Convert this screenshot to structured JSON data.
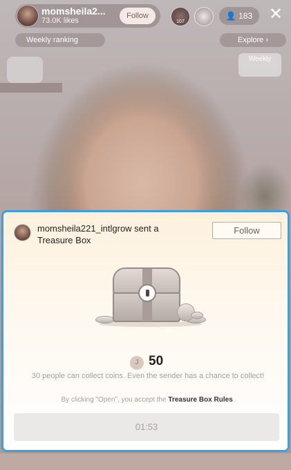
{
  "host": {
    "name": "momsheila2...",
    "likes": "73.0K likes",
    "follow_label": "Follow"
  },
  "viewers": {
    "count": "183",
    "avatar1_badge": "107",
    "avatar2_badge": ""
  },
  "ranking": {
    "label": "Weekly ranking"
  },
  "explore": {
    "label": "Explore"
  },
  "weekly_box": {
    "title": "Weekly",
    "subtitle": ""
  },
  "modal": {
    "sender_text": "momsheila221_intlgrow sent a Treasure Box",
    "follow_label": "Follow",
    "coin_symbol": "J",
    "coin_amount": "50",
    "description": "30 people can collect coins. Even the sender has a chance to collect!",
    "rules_prefix": "By clicking \"Open\", you accept the ",
    "rules_link": "Treasure Box Rules",
    "rules_suffix": ".",
    "timer": "01:53"
  },
  "colors": {
    "modal_border": "#3aa0e6",
    "modal_bg_top": "#fdf1dd",
    "timer_bg": "#ebe8e8"
  },
  "icons": {
    "close": "close-icon",
    "person": "person-icon",
    "trophy": "trophy-icon",
    "explore": "compass-icon",
    "chest": "treasure-chest-icon",
    "coin": "coin-icon"
  }
}
